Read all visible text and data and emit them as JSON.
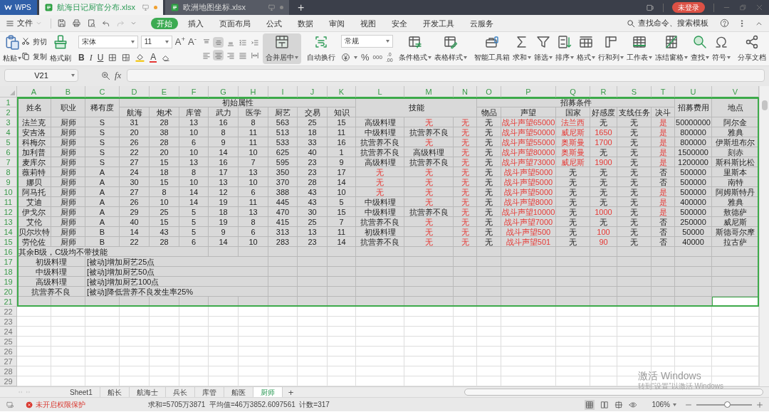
{
  "title_bar": {
    "app_label": "WPS",
    "tabs": [
      {
        "label": "航海日记厨官分布.xlsx",
        "selected": true,
        "unsaved": true
      },
      {
        "label": "欧洲地图坐标.xlsx",
        "selected": false,
        "unsaved": false
      }
    ],
    "new_tab": "+",
    "login_button": "未登录"
  },
  "menu": {
    "file": "文件",
    "tabs": [
      {
        "label": "开始",
        "selected": true
      },
      {
        "label": "插入",
        "selected": false
      },
      {
        "label": "页面布局",
        "selected": false
      },
      {
        "label": "公式",
        "selected": false
      },
      {
        "label": "数据",
        "selected": false
      },
      {
        "label": "审阅",
        "selected": false
      },
      {
        "label": "视图",
        "selected": false
      },
      {
        "label": "安全",
        "selected": false
      },
      {
        "label": "开发工具",
        "selected": false
      },
      {
        "label": "云服务",
        "selected": false
      }
    ],
    "search": "查找命令、搜索模板"
  },
  "ribbon": {
    "paste": "粘贴",
    "cut": "剪切",
    "copy": "复制",
    "format_painter": "格式刷",
    "font_name": "宋体",
    "font_size": "11",
    "grow_font": "A$^{+}$",
    "shrink_font": "A$^{-}$",
    "style_buttons": [
      "B",
      "I",
      "U"
    ],
    "font_color_button": "A",
    "align_buttons": [
      {
        "pressed": false
      },
      {
        "pressed": true
      },
      {
        "pressed": false
      },
      {
        "pressed": false
      },
      {
        "pressed": false
      },
      {
        "pressed": false
      },
      {
        "pressed": true
      },
      {
        "pressed": false
      },
      {
        "pressed": false
      },
      {
        "pressed": false
      }
    ],
    "merge": {
      "label": "合并居中",
      "pressed": true
    },
    "wrap": {
      "label": "自动换行",
      "pressed": false
    },
    "number_format": "常规",
    "percent": "%",
    "thousands": "000",
    "decimals": [
      ".0",
      ".00"
    ],
    "tools": [
      {
        "label": "条件格式",
        "dropdown": true
      },
      {
        "label": "表格样式",
        "dropdown": true
      },
      {
        "label": "智能工具箱",
        "dropdown": false
      },
      {
        "label": "求和",
        "dropdown": true
      },
      {
        "label": "筛选",
        "dropdown": true
      },
      {
        "label": "排序",
        "dropdown": true
      },
      {
        "label": "格式",
        "dropdown": true
      },
      {
        "label": "行和列",
        "dropdown": true
      },
      {
        "label": "工作表",
        "dropdown": true
      },
      {
        "label": "冻结窗格",
        "dropdown": true
      },
      {
        "label": "查找",
        "dropdown": true
      },
      {
        "label": "符号",
        "dropdown": true
      },
      {
        "label": "分享文档",
        "dropdown": false
      }
    ]
  },
  "formula_bar": {
    "name_box": "V21",
    "fx_label": "fx"
  },
  "sheet": {
    "column_letters": [
      {
        "label": "A",
        "selected": true
      },
      {
        "label": "B",
        "selected": true
      },
      {
        "label": "C",
        "selected": true
      },
      {
        "label": "D",
        "selected": true
      },
      {
        "label": "E",
        "selected": true
      },
      {
        "label": "F",
        "selected": true
      },
      {
        "label": "G",
        "selected": true
      },
      {
        "label": "H",
        "selected": true
      },
      {
        "label": "I",
        "selected": true
      },
      {
        "label": "J",
        "selected": true
      },
      {
        "label": "K",
        "selected": true
      },
      {
        "label": "L",
        "selected": true
      },
      {
        "label": "M",
        "selected": true
      },
      {
        "label": "N",
        "selected": true
      },
      {
        "label": "O",
        "selected": true
      },
      {
        "label": "P",
        "selected": true
      },
      {
        "label": "Q",
        "selected": true
      },
      {
        "label": "R",
        "selected": true
      },
      {
        "label": "S",
        "selected": true
      },
      {
        "label": "T",
        "selected": true
      },
      {
        "label": "U",
        "selected": true
      },
      {
        "label": "V",
        "selected": true
      }
    ],
    "row_numbers": [
      {
        "label": "1",
        "selected": true
      },
      {
        "label": "2",
        "selected": true
      },
      {
        "label": "3",
        "selected": true
      },
      {
        "label": "4",
        "selected": true
      },
      {
        "label": "5",
        "selected": true
      },
      {
        "label": "6",
        "selected": true
      },
      {
        "label": "7",
        "selected": true
      },
      {
        "label": "8",
        "selected": true
      },
      {
        "label": "9",
        "selected": true
      },
      {
        "label": "10",
        "selected": true
      },
      {
        "label": "11",
        "selected": true
      },
      {
        "label": "12",
        "selected": true
      },
      {
        "label": "13",
        "selected": true
      },
      {
        "label": "14",
        "selected": true
      },
      {
        "label": "15",
        "selected": true
      },
      {
        "label": "16",
        "selected": true
      },
      {
        "label": "17",
        "selected": true
      },
      {
        "label": "18",
        "selected": true
      },
      {
        "label": "19",
        "selected": true
      },
      {
        "label": "20",
        "selected": true
      },
      {
        "label": "21",
        "selected": true
      },
      {
        "label": "22",
        "selected": false
      },
      {
        "label": "23",
        "selected": false
      },
      {
        "label": "24",
        "selected": false
      },
      {
        "label": "25",
        "selected": false
      },
      {
        "label": "26",
        "selected": false
      },
      {
        "label": "27",
        "selected": false
      },
      {
        "label": "28",
        "selected": false
      },
      {
        "label": "29",
        "selected": false
      }
    ],
    "headers": [
      {
        "text": "姓名"
      },
      {
        "text": "职业"
      },
      {
        "text": "稀有度"
      },
      {
        "text": "初始属性",
        "children": [
          {
            "text": "航海"
          },
          {
            "text": "炮术"
          },
          {
            "text": "库管"
          },
          {
            "text": "武力"
          },
          {
            "text": "医学"
          },
          {
            "text": "厨艺"
          },
          {
            "text": "交易"
          },
          {
            "text": "知识"
          }
        ]
      },
      {
        "text": "技能"
      },
      {
        "text": "招募条件",
        "children": [
          {
            "text": "物品"
          },
          {
            "text": "声望"
          },
          {
            "text": "国家"
          },
          {
            "text": "好感度"
          },
          {
            "text": "支线任务"
          },
          {
            "text": "决斗"
          }
        ]
      },
      {
        "text": "招募费用"
      },
      {
        "text": "地点"
      }
    ],
    "rows": [
      {
        "cells": [
          {
            "text": "法兰克",
            "warn": false
          },
          {
            "text": "厨师",
            "warn": false
          },
          {
            "text": "S",
            "warn": false
          },
          {
            "text": "31",
            "warn": false
          },
          {
            "text": "28",
            "warn": false
          },
          {
            "text": "13",
            "warn": false
          },
          {
            "text": "16",
            "warn": false
          },
          {
            "text": "8",
            "warn": false
          },
          {
            "text": "563",
            "warn": false
          },
          {
            "text": "25",
            "warn": false
          },
          {
            "text": "15",
            "warn": false
          },
          {
            "text": "高级料理",
            "warn": false
          },
          {
            "text": "无",
            "warn": true
          },
          {
            "text": "无",
            "warn": true
          },
          {
            "text": "无",
            "warn": false
          },
          {
            "text": "战斗声望65000",
            "warn": true
          },
          {
            "text": "法兰西",
            "warn": true
          },
          {
            "text": "无",
            "warn": false
          },
          {
            "text": "无",
            "warn": false
          },
          {
            "text": "是",
            "warn": true
          },
          {
            "text": "50000000",
            "warn": false
          },
          {
            "text": "阿尔金",
            "warn": false
          }
        ]
      },
      {
        "cells": [
          {
            "text": "安吉洛",
            "warn": false
          },
          {
            "text": "厨师",
            "warn": false
          },
          {
            "text": "S",
            "warn": false
          },
          {
            "text": "20",
            "warn": false
          },
          {
            "text": "38",
            "warn": false
          },
          {
            "text": "10",
            "warn": false
          },
          {
            "text": "8",
            "warn": false
          },
          {
            "text": "11",
            "warn": false
          },
          {
            "text": "513",
            "warn": false
          },
          {
            "text": "18",
            "warn": false
          },
          {
            "text": "11",
            "warn": false
          },
          {
            "text": "中级料理",
            "warn": false
          },
          {
            "text": "抗营养不良",
            "warn": false
          },
          {
            "text": "无",
            "warn": true
          },
          {
            "text": "无",
            "warn": false
          },
          {
            "text": "战斗声望50000",
            "warn": true
          },
          {
            "text": "威尼斯",
            "warn": true
          },
          {
            "text": "1650",
            "warn": true
          },
          {
            "text": "无",
            "warn": false
          },
          {
            "text": "是",
            "warn": true
          },
          {
            "text": "800000",
            "warn": false
          },
          {
            "text": "雅典",
            "warn": false
          }
        ]
      },
      {
        "cells": [
          {
            "text": "科梅尔",
            "warn": false
          },
          {
            "text": "厨师",
            "warn": false
          },
          {
            "text": "S",
            "warn": false
          },
          {
            "text": "26",
            "warn": false
          },
          {
            "text": "28",
            "warn": false
          },
          {
            "text": "6",
            "warn": false
          },
          {
            "text": "9",
            "warn": false
          },
          {
            "text": "11",
            "warn": false
          },
          {
            "text": "533",
            "warn": false
          },
          {
            "text": "33",
            "warn": false
          },
          {
            "text": "16",
            "warn": false
          },
          {
            "text": "抗营养不良",
            "warn": false
          },
          {
            "text": "无",
            "warn": true
          },
          {
            "text": "无",
            "warn": true
          },
          {
            "text": "无",
            "warn": false
          },
          {
            "text": "战斗声望55000",
            "warn": true
          },
          {
            "text": "奥斯曼",
            "warn": true
          },
          {
            "text": "1700",
            "warn": true
          },
          {
            "text": "无",
            "warn": false
          },
          {
            "text": "是",
            "warn": true
          },
          {
            "text": "800000",
            "warn": false
          },
          {
            "text": "伊斯坦布尔",
            "warn": false
          }
        ]
      },
      {
        "cells": [
          {
            "text": "加利普",
            "warn": false
          },
          {
            "text": "厨师",
            "warn": false
          },
          {
            "text": "S",
            "warn": false
          },
          {
            "text": "22",
            "warn": false
          },
          {
            "text": "20",
            "warn": false
          },
          {
            "text": "10",
            "warn": false
          },
          {
            "text": "14",
            "warn": false
          },
          {
            "text": "10",
            "warn": false
          },
          {
            "text": "625",
            "warn": false
          },
          {
            "text": "40",
            "warn": false
          },
          {
            "text": "1",
            "warn": false
          },
          {
            "text": "抗营养不良",
            "warn": false
          },
          {
            "text": "高级料理",
            "warn": false
          },
          {
            "text": "无",
            "warn": true
          },
          {
            "text": "无",
            "warn": false
          },
          {
            "text": "战斗声望80000",
            "warn": true
          },
          {
            "text": "奥斯曼",
            "warn": true
          },
          {
            "text": "无",
            "warn": false
          },
          {
            "text": "无",
            "warn": false
          },
          {
            "text": "是",
            "warn": true
          },
          {
            "text": "1500000",
            "warn": false
          },
          {
            "text": "刻赤",
            "warn": false
          }
        ]
      },
      {
        "cells": [
          {
            "text": "麦库尔",
            "warn": false
          },
          {
            "text": "厨师",
            "warn": false
          },
          {
            "text": "S",
            "warn": false
          },
          {
            "text": "27",
            "warn": false
          },
          {
            "text": "15",
            "warn": false
          },
          {
            "text": "13",
            "warn": false
          },
          {
            "text": "16",
            "warn": false
          },
          {
            "text": "7",
            "warn": false
          },
          {
            "text": "595",
            "warn": false
          },
          {
            "text": "23",
            "warn": false
          },
          {
            "text": "9",
            "warn": false
          },
          {
            "text": "高级料理",
            "warn": false
          },
          {
            "text": "抗营养不良",
            "warn": false
          },
          {
            "text": "无",
            "warn": true
          },
          {
            "text": "无",
            "warn": false
          },
          {
            "text": "战斗声望73000",
            "warn": true
          },
          {
            "text": "威尼斯",
            "warn": true
          },
          {
            "text": "1900",
            "warn": true
          },
          {
            "text": "无",
            "warn": false
          },
          {
            "text": "是",
            "warn": true
          },
          {
            "text": "1200000",
            "warn": false
          },
          {
            "text": "斯科斯比松",
            "warn": false
          }
        ]
      },
      {
        "cells": [
          {
            "text": "薇莉特",
            "warn": false
          },
          {
            "text": "厨师",
            "warn": false
          },
          {
            "text": "A",
            "warn": false
          },
          {
            "text": "24",
            "warn": false
          },
          {
            "text": "18",
            "warn": false
          },
          {
            "text": "8",
            "warn": false
          },
          {
            "text": "17",
            "warn": false
          },
          {
            "text": "13",
            "warn": false
          },
          {
            "text": "350",
            "warn": false
          },
          {
            "text": "23",
            "warn": false
          },
          {
            "text": "17",
            "warn": false
          },
          {
            "text": "无",
            "warn": true
          },
          {
            "text": "无",
            "warn": true
          },
          {
            "text": "无",
            "warn": true
          },
          {
            "text": "无",
            "warn": false
          },
          {
            "text": "战斗声望5000",
            "warn": true
          },
          {
            "text": "无",
            "warn": false
          },
          {
            "text": "无",
            "warn": false
          },
          {
            "text": "无",
            "warn": false
          },
          {
            "text": "否",
            "warn": false
          },
          {
            "text": "500000",
            "warn": false
          },
          {
            "text": "里斯本",
            "warn": false
          }
        ]
      },
      {
        "cells": [
          {
            "text": "娜贝",
            "warn": false
          },
          {
            "text": "厨师",
            "warn": false
          },
          {
            "text": "A",
            "warn": false
          },
          {
            "text": "30",
            "warn": false
          },
          {
            "text": "15",
            "warn": false
          },
          {
            "text": "10",
            "warn": false
          },
          {
            "text": "13",
            "warn": false
          },
          {
            "text": "10",
            "warn": false
          },
          {
            "text": "370",
            "warn": false
          },
          {
            "text": "28",
            "warn": false
          },
          {
            "text": "14",
            "warn": false
          },
          {
            "text": "无",
            "warn": true
          },
          {
            "text": "无",
            "warn": true
          },
          {
            "text": "无",
            "warn": true
          },
          {
            "text": "无",
            "warn": false
          },
          {
            "text": "战斗声望5000",
            "warn": true
          },
          {
            "text": "无",
            "warn": false
          },
          {
            "text": "无",
            "warn": false
          },
          {
            "text": "无",
            "warn": false
          },
          {
            "text": "否",
            "warn": false
          },
          {
            "text": "500000",
            "warn": false
          },
          {
            "text": "南特",
            "warn": false
          }
        ]
      },
      {
        "cells": [
          {
            "text": "阿马托",
            "warn": false
          },
          {
            "text": "厨师",
            "warn": false
          },
          {
            "text": "A",
            "warn": false
          },
          {
            "text": "27",
            "warn": false
          },
          {
            "text": "8",
            "warn": false
          },
          {
            "text": "14",
            "warn": false
          },
          {
            "text": "12",
            "warn": false
          },
          {
            "text": "6",
            "warn": false
          },
          {
            "text": "388",
            "warn": false
          },
          {
            "text": "43",
            "warn": false
          },
          {
            "text": "10",
            "warn": false
          },
          {
            "text": "无",
            "warn": true
          },
          {
            "text": "无",
            "warn": true
          },
          {
            "text": "无",
            "warn": true
          },
          {
            "text": "无",
            "warn": false
          },
          {
            "text": "战斗声望5000",
            "warn": true
          },
          {
            "text": "无",
            "warn": false
          },
          {
            "text": "无",
            "warn": false
          },
          {
            "text": "无",
            "warn": false
          },
          {
            "text": "是",
            "warn": true
          },
          {
            "text": "500000",
            "warn": false
          },
          {
            "text": "阿姆斯特丹",
            "warn": false
          }
        ]
      },
      {
        "cells": [
          {
            "text": "艾迪",
            "warn": false
          },
          {
            "text": "厨师",
            "warn": false
          },
          {
            "text": "A",
            "warn": false
          },
          {
            "text": "26",
            "warn": false
          },
          {
            "text": "10",
            "warn": false
          },
          {
            "text": "14",
            "warn": false
          },
          {
            "text": "19",
            "warn": false
          },
          {
            "text": "11",
            "warn": false
          },
          {
            "text": "445",
            "warn": false
          },
          {
            "text": "43",
            "warn": false
          },
          {
            "text": "5",
            "warn": false
          },
          {
            "text": "中级料理",
            "warn": false
          },
          {
            "text": "无",
            "warn": true
          },
          {
            "text": "无",
            "warn": true
          },
          {
            "text": "无",
            "warn": false
          },
          {
            "text": "战斗声望8000",
            "warn": true
          },
          {
            "text": "无",
            "warn": false
          },
          {
            "text": "无",
            "warn": false
          },
          {
            "text": "无",
            "warn": false
          },
          {
            "text": "是",
            "warn": true
          },
          {
            "text": "400000",
            "warn": false
          },
          {
            "text": "雅典",
            "warn": false
          }
        ]
      },
      {
        "cells": [
          {
            "text": "伊戈尔",
            "warn": false
          },
          {
            "text": "厨师",
            "warn": false
          },
          {
            "text": "A",
            "warn": false
          },
          {
            "text": "29",
            "warn": false
          },
          {
            "text": "25",
            "warn": false
          },
          {
            "text": "5",
            "warn": false
          },
          {
            "text": "18",
            "warn": false
          },
          {
            "text": "13",
            "warn": false
          },
          {
            "text": "470",
            "warn": false
          },
          {
            "text": "30",
            "warn": false
          },
          {
            "text": "15",
            "warn": false
          },
          {
            "text": "中级料理",
            "warn": false
          },
          {
            "text": "抗营养不良",
            "warn": false
          },
          {
            "text": "无",
            "warn": true
          },
          {
            "text": "无",
            "warn": false
          },
          {
            "text": "战斗声望10000",
            "warn": true
          },
          {
            "text": "无",
            "warn": false
          },
          {
            "text": "1000",
            "warn": true
          },
          {
            "text": "无",
            "warn": false
          },
          {
            "text": "是",
            "warn": true
          },
          {
            "text": "500000",
            "warn": false
          },
          {
            "text": "敖德萨",
            "warn": false
          }
        ]
      },
      {
        "cells": [
          {
            "text": "艾伦",
            "warn": false
          },
          {
            "text": "厨师",
            "warn": false
          },
          {
            "text": "A",
            "warn": false
          },
          {
            "text": "40",
            "warn": false
          },
          {
            "text": "15",
            "warn": false
          },
          {
            "text": "5",
            "warn": false
          },
          {
            "text": "19",
            "warn": false
          },
          {
            "text": "8",
            "warn": false
          },
          {
            "text": "415",
            "warn": false
          },
          {
            "text": "25",
            "warn": false
          },
          {
            "text": "7",
            "warn": false
          },
          {
            "text": "抗营养不良",
            "warn": false
          },
          {
            "text": "无",
            "warn": true
          },
          {
            "text": "无",
            "warn": true
          },
          {
            "text": "无",
            "warn": false
          },
          {
            "text": "战斗声望7000",
            "warn": true
          },
          {
            "text": "无",
            "warn": false
          },
          {
            "text": "无",
            "warn": false
          },
          {
            "text": "无",
            "warn": false
          },
          {
            "text": "否",
            "warn": false
          },
          {
            "text": "250000",
            "warn": false
          },
          {
            "text": "威尼斯",
            "warn": false
          }
        ]
      },
      {
        "cells": [
          {
            "text": "贝尔坎特",
            "warn": false
          },
          {
            "text": "厨师",
            "warn": false
          },
          {
            "text": "B",
            "warn": false
          },
          {
            "text": "14",
            "warn": false
          },
          {
            "text": "43",
            "warn": false
          },
          {
            "text": "5",
            "warn": false
          },
          {
            "text": "9",
            "warn": false
          },
          {
            "text": "6",
            "warn": false
          },
          {
            "text": "313",
            "warn": false
          },
          {
            "text": "13",
            "warn": false
          },
          {
            "text": "11",
            "warn": false
          },
          {
            "text": "初级料理",
            "warn": false
          },
          {
            "text": "无",
            "warn": true
          },
          {
            "text": "无",
            "warn": true
          },
          {
            "text": "无",
            "warn": false
          },
          {
            "text": "战斗声望500",
            "warn": true
          },
          {
            "text": "无",
            "warn": false
          },
          {
            "text": "100",
            "warn": true
          },
          {
            "text": "无",
            "warn": false
          },
          {
            "text": "否",
            "warn": false
          },
          {
            "text": "50000",
            "warn": false
          },
          {
            "text": "斯德哥尔摩",
            "warn": false
          }
        ]
      },
      {
        "cells": [
          {
            "text": "劳伦佐",
            "warn": false
          },
          {
            "text": "厨师",
            "warn": false
          },
          {
            "text": "B",
            "warn": false
          },
          {
            "text": "22",
            "warn": false
          },
          {
            "text": "28",
            "warn": false
          },
          {
            "text": "6",
            "warn": false
          },
          {
            "text": "14",
            "warn": false
          },
          {
            "text": "10",
            "warn": false
          },
          {
            "text": "283",
            "warn": false
          },
          {
            "text": "23",
            "warn": false
          },
          {
            "text": "14",
            "warn": false
          },
          {
            "text": "抗营养不良",
            "warn": false
          },
          {
            "text": "无",
            "warn": true
          },
          {
            "text": "无",
            "warn": true
          },
          {
            "text": "无",
            "warn": false
          },
          {
            "text": "战斗声望501",
            "warn": true
          },
          {
            "text": "无",
            "warn": false
          },
          {
            "text": "90",
            "warn": true
          },
          {
            "text": "无",
            "warn": false
          },
          {
            "text": "否",
            "warn": false
          },
          {
            "text": "40000",
            "warn": false
          },
          {
            "text": "拉古萨",
            "warn": false
          }
        ]
      }
    ],
    "remark": "其余B级，C级均不带技能",
    "skills": [
      {
        "name": "初级料理",
        "description": "[被动]增加厨艺25点"
      },
      {
        "name": "中级料理",
        "description": "[被动]增加厨艺50点"
      },
      {
        "name": "高级料理",
        "description": "[被动]增加厨艺100点"
      },
      {
        "name": "抗营养不良",
        "description": "[被动]降低营养不良发生率25%"
      }
    ]
  },
  "sheet_tabs": {
    "tabs": [
      {
        "label": "Sheet1",
        "selected": false
      },
      {
        "label": "船长",
        "selected": false
      },
      {
        "label": "航海士",
        "selected": false
      },
      {
        "label": "兵长",
        "selected": false
      },
      {
        "label": "库管",
        "selected": false
      },
      {
        "label": "船医",
        "selected": false
      },
      {
        "label": "厨师",
        "selected": true
      }
    ],
    "add": "+"
  },
  "activation_notice": {
    "title": "激活 Windows",
    "subtitle": "转到“设置”以激活 Windows"
  },
  "status_bar": {
    "protection": "未开启权限保护",
    "summary": "求和=5705万3871  平均值=46万3852.6097561  计数=317",
    "zoom": "106%",
    "zoom_slider": {
      "level": 0.55
    }
  }
}
